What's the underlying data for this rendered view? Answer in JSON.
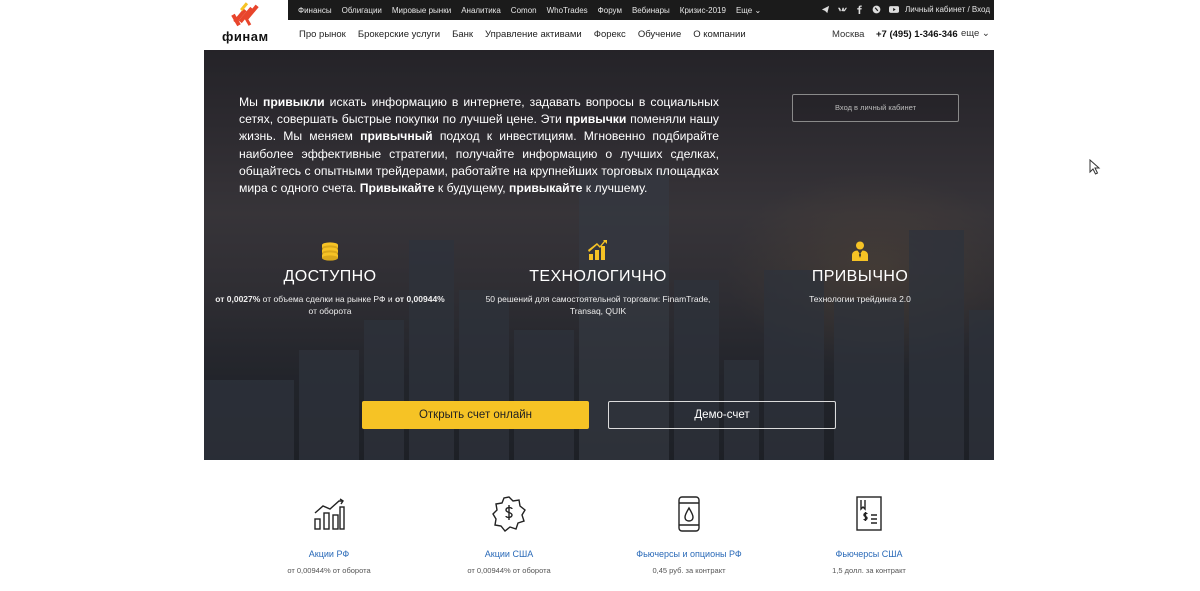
{
  "topbar": {
    "links": [
      "Финансы",
      "Облигации",
      "Мировые рынки",
      "Аналитика",
      "Comon",
      "WhoTrades",
      "Форум",
      "Вебинары",
      "Кризис-2019",
      "Еще ⌄"
    ],
    "social_icons": [
      "telegram-icon",
      "vk-icon",
      "facebook-icon",
      "livejournal-icon",
      "youtube-icon"
    ],
    "cabinet_label": "Личный кабинет / Вход"
  },
  "logo": {
    "text": "финам"
  },
  "mainnav": {
    "items": [
      "Про рынок",
      "Брокерские услуги",
      "Банк",
      "Управление активами",
      "Форекс",
      "Обучение",
      "О компании"
    ],
    "city": "Москва",
    "phone": "+7 (495) 1-346-346",
    "more": "еще ⌄"
  },
  "hero": {
    "intro": [
      {
        "t": "Мы ",
        "b": false
      },
      {
        "t": "привыкли",
        "b": true
      },
      {
        "t": " искать информацию в интернете, задавать вопросы в социальных сетях, совершать быстрые покупки по лучшей цене. Эти ",
        "b": false
      },
      {
        "t": "привычки",
        "b": true
      },
      {
        "t": " поменяли нашу жизнь. Мы меняем ",
        "b": false
      },
      {
        "t": "привычный",
        "b": true
      },
      {
        "t": " подход к инвестициям. Мгновенно подбирайте наиболее эффективные стратегии, получайте информацию о лучших сделках, общайтесь с опытными трейдерами, работайте на крупнейших торговых площадках мира с одного счета. ",
        "b": false
      },
      {
        "t": "Привыкайте",
        "b": true
      },
      {
        "t": " к будущему, ",
        "b": false
      },
      {
        "t": "привыкайте",
        "b": true
      },
      {
        "t": " к лучшему.",
        "b": false
      }
    ],
    "login_button": "Вход в личный кабинет",
    "features": [
      {
        "icon": "coins-icon",
        "title": "ДОСТУПНО",
        "desc": [
          {
            "t": "от 0,0027%",
            "b": true
          },
          {
            "t": " от объема сделки на рынке РФ и ",
            "b": false
          },
          {
            "t": "от 0,00944%",
            "b": true
          },
          {
            "t": " от оборота",
            "b": false
          }
        ]
      },
      {
        "icon": "growth-chart-icon",
        "title": "ТЕХНОЛОГИЧНО",
        "desc": [
          {
            "t": "50 решений для самостоятельной торговли: FinamTrade, Transaq, QUIK",
            "b": false
          }
        ]
      },
      {
        "icon": "person-icon",
        "title": "ПРИВЫЧНО",
        "desc": [
          {
            "t": "Технологии трейдинга 2.0",
            "b": false
          }
        ]
      }
    ],
    "open_account_button": "Открыть счет онлайн",
    "demo_button": "Демо-счет"
  },
  "products": [
    {
      "icon": "bar-chart-icon",
      "title": "Акции РФ",
      "desc": "от 0,00944% от оборота"
    },
    {
      "icon": "dollar-badge-icon",
      "title": "Акции США",
      "desc": "от 0,00944% от оборота"
    },
    {
      "icon": "oil-barrel-icon",
      "title": "Фьючерсы и опционы РФ",
      "desc": "0,45 руб. за контракт"
    },
    {
      "icon": "dollar-document-icon",
      "title": "Фьючерсы США",
      "desc": "1,5 долл. за контракт"
    }
  ],
  "colors": {
    "accent_yellow": "#f6c325",
    "link_blue": "#2a6ab8",
    "topbar_bg": "#1b1b1b",
    "logo_red": "#e8452c"
  }
}
